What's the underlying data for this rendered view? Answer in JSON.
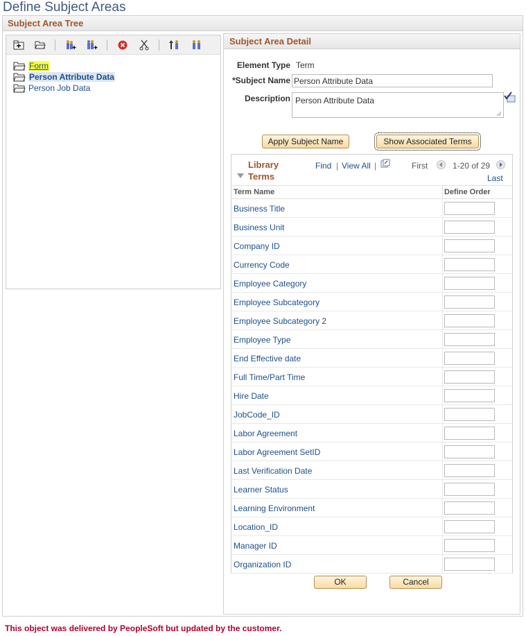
{
  "page": {
    "title": "Define Subject Areas",
    "footer_note": "This object was delivered by PeopleSoft but updated by the customer."
  },
  "tree_panel": {
    "header": "Subject Area Tree",
    "toolbar": [
      {
        "icon": "add-folder-icon"
      },
      {
        "icon": "open-folder-icon"
      },
      {
        "icon": "insert-child-icon"
      },
      {
        "icon": "insert-sibling-icon"
      },
      {
        "icon": "delete-icon"
      },
      {
        "icon": "cut-icon"
      },
      {
        "icon": "move-up-icon"
      },
      {
        "icon": "move-down-icon"
      }
    ],
    "nodes": [
      {
        "label": "Form",
        "state": "highlighted"
      },
      {
        "label": "Person Attribute Data",
        "state": "selected"
      },
      {
        "label": "Person Job Data",
        "state": "normal"
      }
    ]
  },
  "detail": {
    "header": "Subject Area Detail",
    "element_type_label": "Element Type",
    "element_type_value": "Term",
    "subject_name_label": "*Subject Name",
    "subject_name_value": "Person Attribute Data",
    "description_label": "Description",
    "description_value": "Person Attribute Data",
    "apply_button": "Apply Subject Name",
    "show_terms_button": "Show Associated Terms"
  },
  "grid": {
    "title": "Library Terms",
    "find": "Find",
    "view_all": "View All",
    "first": "First",
    "range": "1-20 of 29",
    "last": "Last",
    "col_term": "Term Name",
    "col_order": "Define Order",
    "rows": [
      {
        "term": "Business Title",
        "order": ""
      },
      {
        "term": "Business Unit",
        "order": ""
      },
      {
        "term": "Company ID",
        "order": ""
      },
      {
        "term": "Currency Code",
        "order": ""
      },
      {
        "term": "Employee Category",
        "order": ""
      },
      {
        "term": "Employee Subcategory",
        "order": ""
      },
      {
        "term": "Employee Subcategory 2",
        "order": ""
      },
      {
        "term": "Employee Type",
        "order": ""
      },
      {
        "term": "End Effective date",
        "order": ""
      },
      {
        "term": "Full Time/Part Time",
        "order": ""
      },
      {
        "term": "Hire Date",
        "order": ""
      },
      {
        "term": "JobCode_ID",
        "order": ""
      },
      {
        "term": "Labor Agreement",
        "order": ""
      },
      {
        "term": "Labor Agreement SetID",
        "order": ""
      },
      {
        "term": "Last Verification Date",
        "order": ""
      },
      {
        "term": "Learner Status",
        "order": ""
      },
      {
        "term": "Learning Environment",
        "order": ""
      },
      {
        "term": "Location_ID",
        "order": ""
      },
      {
        "term": "Manager ID",
        "order": ""
      },
      {
        "term": "Organization ID",
        "order": ""
      }
    ]
  },
  "actions": {
    "ok": "OK",
    "cancel": "Cancel"
  }
}
